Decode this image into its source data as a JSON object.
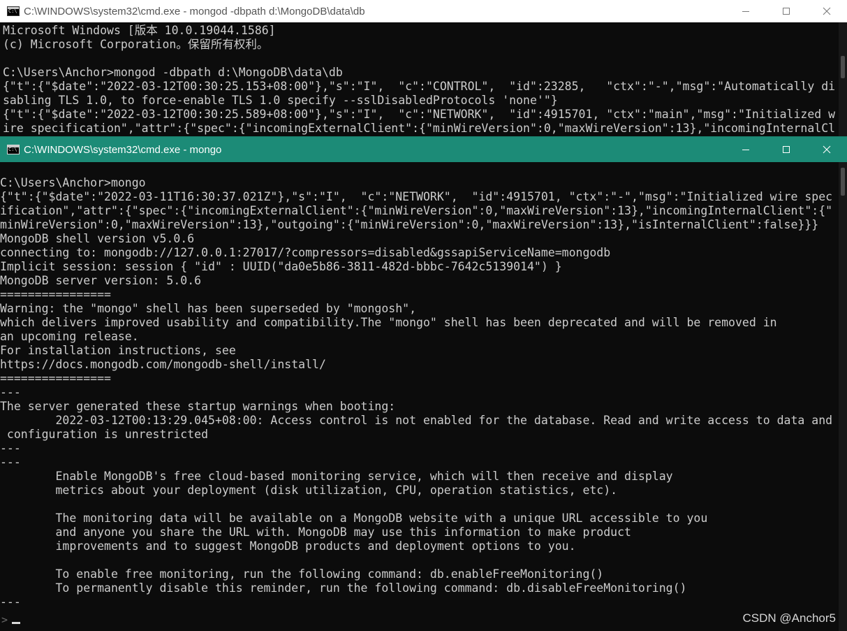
{
  "back_window": {
    "title": "C:\\WINDOWS\\system32\\cmd.exe - mongod  -dbpath d:\\MongoDB\\data\\db",
    "lines": [
      "Microsoft Windows [版本 10.0.19044.1586]",
      "(c) Microsoft Corporation。保留所有权利。",
      "",
      "C:\\Users\\Anchor>mongod -dbpath d:\\MongoDB\\data\\db",
      "{\"t\":{\"$date\":\"2022-03-12T00:30:25.153+08:00\"},\"s\":\"I\",  \"c\":\"CONTROL\",  \"id\":23285,   \"ctx\":\"-\",\"msg\":\"Automatically di",
      "sabling TLS 1.0, to force-enable TLS 1.0 specify --sslDisabledProtocols 'none'\"}",
      "{\"t\":{\"$date\":\"2022-03-12T00:30:25.589+08:00\"},\"s\":\"I\",  \"c\":\"NETWORK\",  \"id\":4915701, \"ctx\":\"main\",\"msg\":\"Initialized w",
      "ire specification\",\"attr\":{\"spec\":{\"incomingExternalClient\":{\"minWireVersion\":0,\"maxWireVersion\":13},\"incomingInternalCl"
    ]
  },
  "front_window": {
    "title": "C:\\WINDOWS\\system32\\cmd.exe - mongo",
    "lines": [
      "C:\\Users\\Anchor>mongo",
      "{\"t\":{\"$date\":\"2022-03-11T16:30:37.021Z\"},\"s\":\"I\",  \"c\":\"NETWORK\",  \"id\":4915701, \"ctx\":\"-\",\"msg\":\"Initialized wire spec",
      "ification\",\"attr\":{\"spec\":{\"incomingExternalClient\":{\"minWireVersion\":0,\"maxWireVersion\":13},\"incomingInternalClient\":{\"",
      "minWireVersion\":0,\"maxWireVersion\":13},\"outgoing\":{\"minWireVersion\":0,\"maxWireVersion\":13},\"isInternalClient\":false}}}",
      "MongoDB shell version v5.0.6",
      "connecting to: mongodb://127.0.0.1:27017/?compressors=disabled&gssapiServiceName=mongodb",
      "Implicit session: session { \"id\" : UUID(\"da0e5b86-3811-482d-bbbc-7642c5139014\") }",
      "MongoDB server version: 5.0.6",
      "================",
      "Warning: the \"mongo\" shell has been superseded by \"mongosh\",",
      "which delivers improved usability and compatibility.The \"mongo\" shell has been deprecated and will be removed in",
      "an upcoming release.",
      "For installation instructions, see",
      "https://docs.mongodb.com/mongodb-shell/install/",
      "================",
      "---",
      "The server generated these startup warnings when booting:",
      "        2022-03-12T00:13:29.045+08:00: Access control is not enabled for the database. Read and write access to data and",
      " configuration is unrestricted",
      "---",
      "---",
      "        Enable MongoDB's free cloud-based monitoring service, which will then receive and display",
      "        metrics about your deployment (disk utilization, CPU, operation statistics, etc).",
      "",
      "        The monitoring data will be available on a MongoDB website with a unique URL accessible to you",
      "        and anyone you share the URL with. MongoDB may use this information to make product",
      "        improvements and to suggest MongoDB products and deployment options to you.",
      "",
      "        To enable free monitoring, run the following command: db.enableFreeMonitoring()",
      "        To permanently disable this reminder, run the following command: db.disableFreeMonitoring()",
      "---"
    ],
    "prompt": ">"
  },
  "watermark": "CSDN @Anchor5",
  "icons": [
    "cmd-app-icon",
    "minimize-icon",
    "maximize-icon",
    "close-icon"
  ],
  "colors": {
    "console_bg": "#0c0c0c",
    "console_text": "#cccccc",
    "active_titlebar": "#1c8b77",
    "inactive_titlebar": "#ffffff"
  }
}
